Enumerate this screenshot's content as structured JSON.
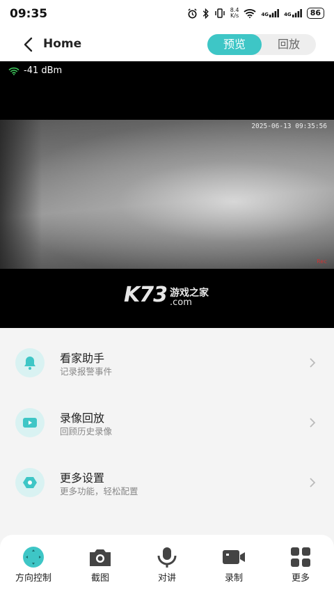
{
  "status_bar": {
    "time": "09:35",
    "net_speed_top": "8.4",
    "net_speed_unit": "K/s",
    "sim1": "4G",
    "sim2": "4G",
    "battery": "86"
  },
  "header": {
    "title": "Home",
    "tabs": [
      {
        "label": "预览",
        "active": true
      },
      {
        "label": "回放",
        "active": false
      }
    ]
  },
  "video": {
    "signal": "-41 dBm",
    "timestamp": "2025-06-13 09:35:56",
    "rec_label": "Rec",
    "watermark": {
      "logo": "K73",
      "cn": "游戏之家",
      "domain": ".com"
    }
  },
  "menu": [
    {
      "title": "看家助手",
      "subtitle": "记录报警事件",
      "icon": "alarm-bell-icon"
    },
    {
      "title": "录像回放",
      "subtitle": "回顾历史录像",
      "icon": "video-play-icon"
    },
    {
      "title": "更多设置",
      "subtitle": "更多功能，轻松配置",
      "icon": "settings-icon"
    }
  ],
  "bottom_tabs": [
    {
      "label": "方向控制",
      "icon": "direction-control-icon"
    },
    {
      "label": "截图",
      "icon": "camera-icon"
    },
    {
      "label": "对讲",
      "icon": "intercom-icon"
    },
    {
      "label": "录制",
      "icon": "record-icon"
    },
    {
      "label": "更多",
      "icon": "more-grid-icon"
    }
  ],
  "colors": {
    "accent": "#3ec6c6",
    "accent_light": "#d9f2f2",
    "background": "#f4f4f4"
  }
}
